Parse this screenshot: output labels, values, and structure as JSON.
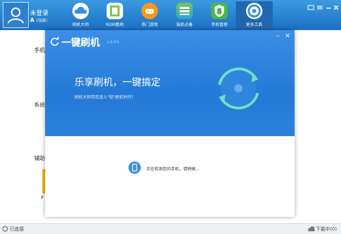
{
  "user": {
    "name": "未登录",
    "sub_letter": "A",
    "sub_status": "(隐藏)"
  },
  "nav": [
    {
      "label": "刷机大师"
    },
    {
      "label": "ROM基地"
    },
    {
      "label": "热门游戏"
    },
    {
      "label": "装机必备"
    },
    {
      "label": "手机管理"
    },
    {
      "label": "更多工具"
    }
  ],
  "sidebar": {
    "phone_label": "手机",
    "system_label": "系统",
    "assist_label": "辅助",
    "card_letter": "F"
  },
  "dialog": {
    "title": "一键刷机",
    "version": "v 1.0.1",
    "slogan": "乐享刷机，一键搞定",
    "tagline": "刷机大师带您进入\"轻\"刷机时代！",
    "status_text": "正在检测您的手机，请稍候..."
  },
  "statusbar": {
    "connection": "已连接",
    "download": "下载中(0)"
  },
  "colors": {
    "header_blue": "#1b6fc4",
    "dialog_blue": "#2479d6",
    "accent_green": "#7ec84a"
  }
}
